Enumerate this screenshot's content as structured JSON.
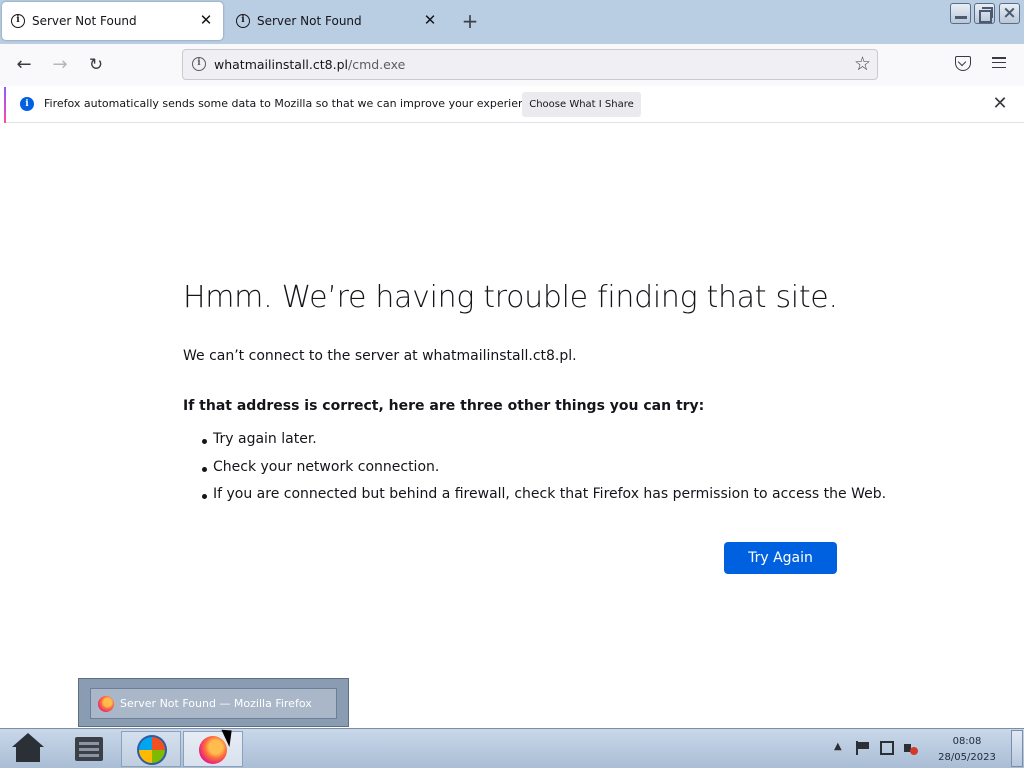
{
  "tabs": [
    {
      "title": "Server Not Found",
      "active": true
    },
    {
      "title": "Server Not Found",
      "active": false
    }
  ],
  "tab_close_glyph": "✕",
  "new_tab_glyph": "+",
  "icons": {
    "tab": "info-icon",
    "url": "info-icon",
    "notice": "info-icon",
    "window": [
      "minimize-icon",
      "maximize-icon",
      "close-icon"
    ]
  },
  "nav": {
    "back_glyph": "←",
    "forward_glyph": "→",
    "reload_glyph": "↻",
    "url_domain": "whatmailinstall.ct8.pl",
    "url_path": "/cmd.exe",
    "star_glyph": "☆"
  },
  "notice": {
    "text": "Firefox automatically sends some data to Mozilla so that we can improve your experience.",
    "button": "Choose What I Share",
    "close_glyph": "✕"
  },
  "error": {
    "title": "Hmm. We’re having trouble finding that site.",
    "description": "We can’t connect to the server at whatmailinstall.ct8.pl.",
    "subheading": "If that address is correct, here are three other things you can try:",
    "tips": [
      "Try again later.",
      "Check your network connection.",
      "If you are connected but behind a firewall, check that Firefox has permission to access the Web."
    ],
    "button": "Try Again"
  },
  "taskbar": {
    "preview_label": "Server Not Found — Mozilla Firefox",
    "tray_up_glyph": "▲",
    "clock_time": "08:08",
    "clock_date": "28/05/2023"
  },
  "colors": {
    "tabstrip": "#b9cde3",
    "accent_button": "#0061e0",
    "notice_icon": "#0060df"
  }
}
